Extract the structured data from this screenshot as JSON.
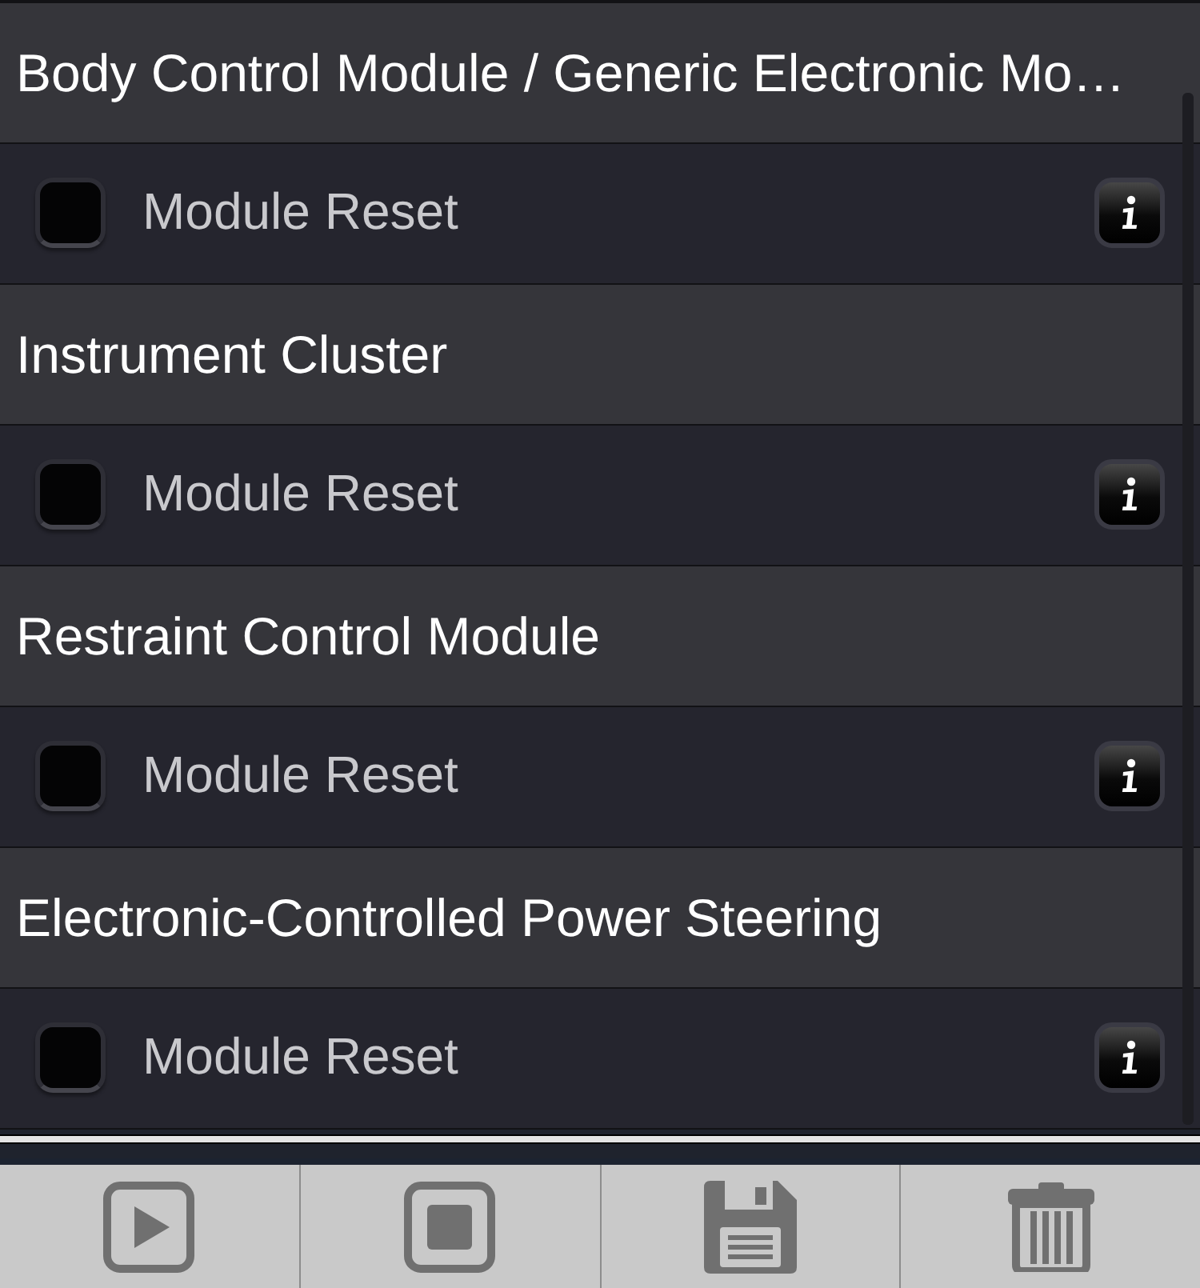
{
  "sections": [
    {
      "title": "Body Control Module / Generic Electronic Mo…",
      "items": [
        {
          "label": "Module Reset",
          "checked": false
        }
      ]
    },
    {
      "title": "Instrument Cluster",
      "items": [
        {
          "label": "Module Reset",
          "checked": false
        }
      ]
    },
    {
      "title": "Restraint Control Module",
      "items": [
        {
          "label": "Module Reset",
          "checked": false
        }
      ]
    },
    {
      "title": "Electronic-Controlled Power Steering",
      "items": [
        {
          "label": "Module Reset",
          "checked": false
        }
      ]
    }
  ],
  "toolbar": {
    "buttons": [
      {
        "kind": "play"
      },
      {
        "kind": "stop"
      },
      {
        "kind": "save"
      },
      {
        "kind": "delete"
      }
    ]
  }
}
